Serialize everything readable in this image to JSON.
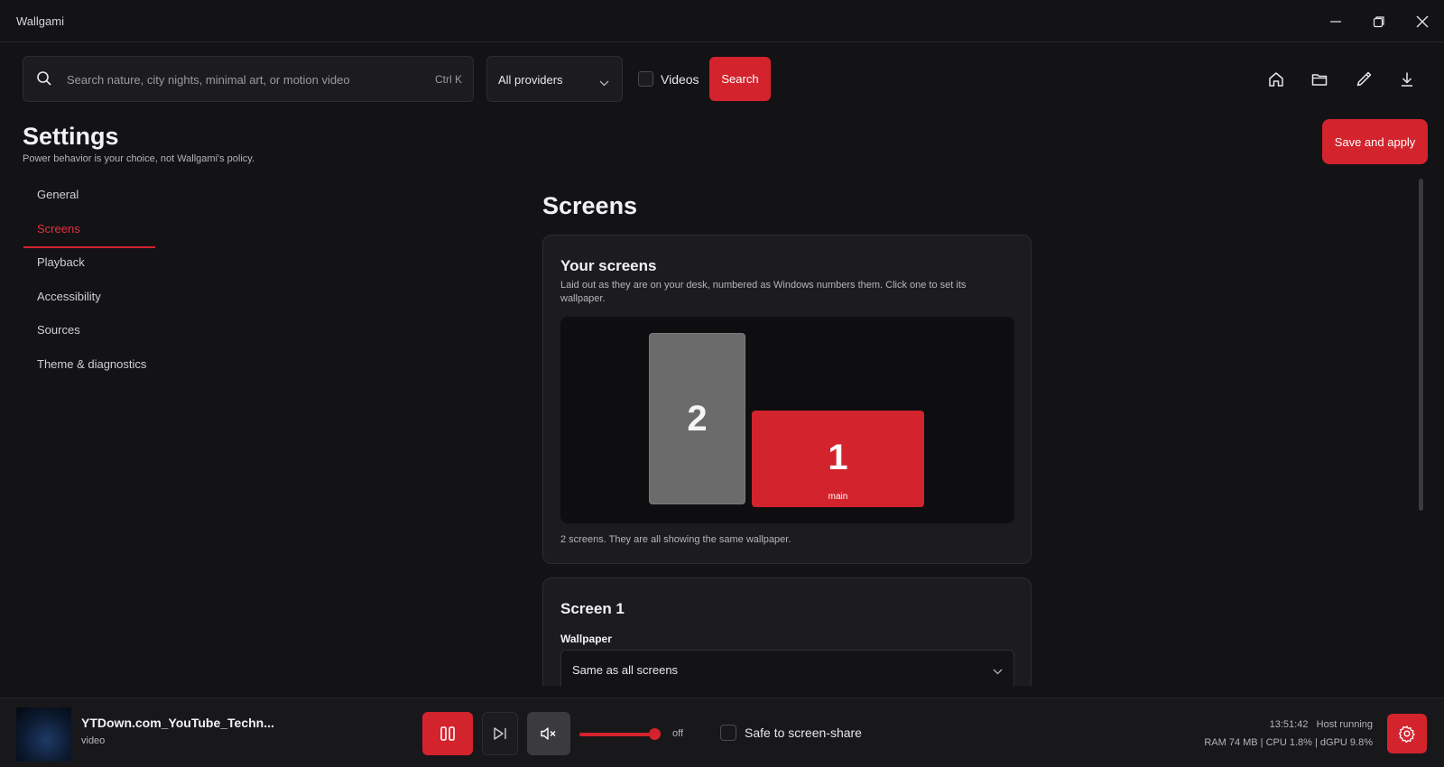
{
  "window": {
    "title": "Wallgami"
  },
  "toolbar": {
    "search_placeholder": "Search nature, city nights, minimal art, or motion video",
    "search_value": "",
    "search_shortcut": "Ctrl K",
    "provider_selected": "All providers",
    "videos_label": "Videos",
    "videos_checked": false,
    "search_button": "Search",
    "nav_icons": [
      "home-icon",
      "folder-icon",
      "brush-icon",
      "download-icon"
    ]
  },
  "page": {
    "title": "Settings",
    "subtitle": "Power behavior is your choice, not Wallgami's policy.",
    "save_button": "Save and apply"
  },
  "sidebar": {
    "items": [
      {
        "label": "General",
        "active": false
      },
      {
        "label": "Screens",
        "active": true
      },
      {
        "label": "Playback",
        "active": false
      },
      {
        "label": "Accessibility",
        "active": false
      },
      {
        "label": "Sources",
        "active": false
      },
      {
        "label": "Theme & diagnostics",
        "active": false
      }
    ]
  },
  "screens_section": {
    "title": "Screens",
    "your_screens": {
      "title": "Your screens",
      "description": "Laid out as they are on your desk, numbered as Windows numbers them. Click one to set its wallpaper.",
      "screen_2_label": "2",
      "screen_1_label": "1",
      "screen_1_tag": "main",
      "note": "2 screens. They are all showing the same wallpaper."
    },
    "screen_1": {
      "title": "Screen 1",
      "wallpaper_label": "Wallpaper",
      "wallpaper_value": "Same as all screens"
    }
  },
  "player": {
    "track_title": "YTDown.com_YouTube_Techn...",
    "track_type": "video",
    "volume_fraction": 0.92,
    "volume_label": "off",
    "share_label": "Safe to screen-share",
    "share_checked": false,
    "status_line_1": "13:51:42   Host running",
    "status_line_2": "RAM 74 MB | CPU 1.8% | dGPU 9.8%"
  },
  "colors": {
    "accent": "#d3232d",
    "background": "#131316",
    "card": "#1c1c20"
  }
}
